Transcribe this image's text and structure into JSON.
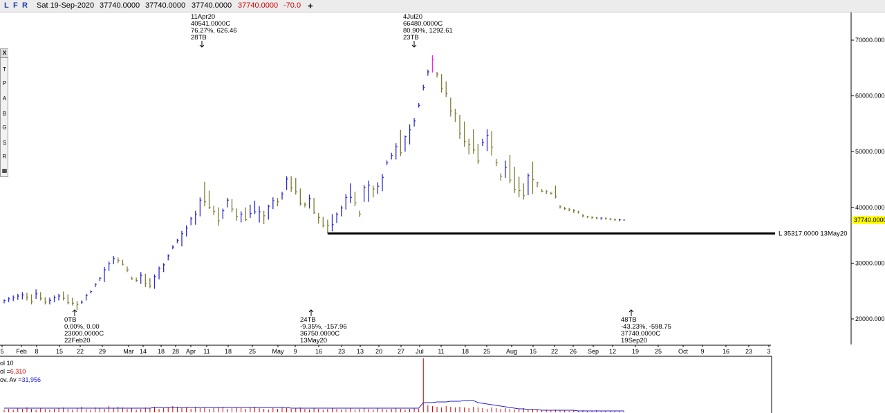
{
  "topbar": {
    "modes": [
      {
        "label": "L",
        "name": "line-mode-button"
      },
      {
        "label": "F",
        "name": "fullscreen-mode-button"
      },
      {
        "label": "R",
        "name": "refresh-mode-button"
      }
    ],
    "date": "Sat 19-Sep-2020",
    "open": "37740.0000",
    "high": "37740.0000",
    "low": "37740.0000",
    "close": "37740.0000",
    "change": "-70.0",
    "add_icon": "plus-icon"
  },
  "toolbar": {
    "close_label": "X",
    "tools": [
      {
        "label": "T",
        "name": "text-tool-button"
      },
      {
        "label": "P",
        "name": "pencil-tool-button"
      },
      {
        "label": "A",
        "name": "arrow-tool-button"
      },
      {
        "label": "B",
        "name": "box-tool-button"
      },
      {
        "label": "G",
        "name": "gann-tool-button"
      },
      {
        "label": "S",
        "name": "speedline-tool-button"
      },
      {
        "label": "R",
        "name": "retracement-tool-button"
      },
      {
        "label": "▦",
        "name": "grid-tool-button"
      }
    ]
  },
  "colors": {
    "up_bar": "#2a2acf",
    "down_bar": "#7f7a33",
    "peak_bar": "#ee22ee",
    "support_line": "#000000",
    "volume_bar": "#d00000",
    "volume_avg": "#2222cc",
    "last_price_bg": "#ffff00"
  },
  "chart_data": {
    "type": "bar",
    "instrument_ohlc_style": "high-low bars with close ticks",
    "y_ticks": [
      "70000.000",
      "60000.000",
      "50000.000",
      "40000.000",
      "30000.000",
      "20000.000"
    ],
    "ylim": [
      16500,
      74000
    ],
    "last_price": "37740.0000",
    "x_labels": [
      "5",
      "Feb",
      "8",
      "15",
      "22",
      "29",
      "Mar",
      "14",
      "18",
      "28",
      "Apr",
      "11",
      "18",
      "25",
      "May",
      "9",
      "16",
      "23",
      "13",
      "20",
      "27",
      "Jul",
      "11",
      "18",
      "25",
      "Aug",
      "15",
      "22",
      "26",
      "Sep",
      "12",
      "19",
      "25",
      "Oct",
      "9",
      "16",
      "23",
      "3"
    ],
    "support_line": {
      "label": "L 35317.0000 13May20",
      "value": 35317
    },
    "annotations": {
      "high_apr": [
        "11Apr20",
        "40541.0000C",
        "76.27%, 626.46",
        "28TB"
      ],
      "high_jul": [
        "4Jul20",
        "66480.0000C",
        "80.90%, 1292.61",
        "23TB"
      ],
      "low_feb": [
        "0TB",
        "0.00%, 0.00",
        "23000.0000C",
        "22Feb20"
      ],
      "low_may": [
        "24TB",
        "-9.35%, -157.96",
        "36750.0000C",
        "13May20"
      ],
      "last_sep": [
        "48TB",
        "-43.23%, -598.75",
        "37740.0000C",
        "19Sep20"
      ]
    },
    "series": [
      {
        "name": "",
        "bars": [
          [
            23500,
            22800,
            23300
          ],
          [
            23900,
            23000,
            23600
          ],
          [
            24200,
            23200,
            23900
          ],
          [
            24500,
            23400,
            24100
          ],
          [
            24800,
            23500,
            24300
          ],
          [
            24700,
            23300,
            23900
          ],
          [
            24400,
            22600,
            23100
          ],
          [
            25300,
            23600,
            24500
          ],
          [
            24800,
            23300,
            23700
          ],
          [
            23900,
            22600,
            23000
          ],
          [
            23800,
            22600,
            23300
          ],
          [
            24200,
            23000,
            23800
          ],
          [
            24500,
            23300,
            24100
          ],
          [
            24900,
            23300,
            23700
          ],
          [
            24400,
            22600,
            22900
          ],
          [
            23800,
            22400,
            22800
          ],
          [
            23200,
            21600,
            22600
          ],
          [
            23300,
            22700,
            23000
          ],
          [
            24500,
            23300,
            24200
          ],
          [
            25100,
            24600,
            24900
          ],
          [
            26400,
            25700,
            26200
          ],
          [
            27500,
            26800,
            27300
          ],
          [
            29300,
            26600,
            28800
          ],
          [
            30300,
            28600,
            29900
          ],
          [
            31300,
            29800,
            30800
          ],
          [
            31000,
            30000,
            30500
          ],
          [
            30600,
            29600,
            29800
          ],
          [
            29400,
            28400,
            28800
          ],
          [
            27600,
            27000,
            27200
          ],
          [
            27400,
            26600,
            26900
          ],
          [
            28400,
            26300,
            27800
          ],
          [
            28100,
            25700,
            26300
          ],
          [
            27300,
            25500,
            25900
          ],
          [
            28000,
            25400,
            27600
          ],
          [
            29400,
            27100,
            29000
          ],
          [
            30000,
            28400,
            29700
          ],
          [
            31600,
            30500,
            31300
          ],
          [
            33200,
            32500,
            32900
          ],
          [
            34400,
            33600,
            34100
          ],
          [
            35800,
            33000,
            35300
          ],
          [
            36800,
            34800,
            36300
          ],
          [
            38300,
            36800,
            38000
          ],
          [
            39400,
            36900,
            38800
          ],
          [
            41800,
            38400,
            41300
          ],
          [
            44600,
            40200,
            41000
          ],
          [
            43000,
            39700,
            40000
          ],
          [
            40300,
            38600,
            39300
          ],
          [
            40000,
            36700,
            37600
          ],
          [
            39800,
            37900,
            39400
          ],
          [
            41700,
            40000,
            41300
          ],
          [
            41500,
            39100,
            39700
          ],
          [
            39800,
            37600,
            38400
          ],
          [
            39300,
            37300,
            38800
          ],
          [
            40000,
            37500,
            37800
          ],
          [
            40500,
            38100,
            38900
          ],
          [
            41200,
            38800,
            39200
          ],
          [
            40200,
            37300,
            39200
          ],
          [
            39400,
            37000,
            38500
          ],
          [
            40500,
            37800,
            40200
          ],
          [
            41800,
            39700,
            41200
          ],
          [
            41700,
            40200,
            41000
          ],
          [
            42800,
            41400,
            42400
          ],
          [
            45600,
            43100,
            45100
          ],
          [
            45600,
            42800,
            43500
          ],
          [
            45300,
            42300,
            42800
          ],
          [
            43400,
            40300,
            40700
          ],
          [
            40900,
            40000,
            40500
          ],
          [
            42300,
            39800,
            41600
          ],
          [
            41700,
            38800,
            39100
          ],
          [
            39000,
            37100,
            38200
          ],
          [
            38300,
            36400,
            36800
          ],
          [
            37800,
            35317,
            36750
          ],
          [
            38800,
            35700,
            36900
          ],
          [
            39100,
            37200,
            38700
          ],
          [
            40300,
            38400,
            39900
          ],
          [
            42400,
            39600,
            41800
          ],
          [
            44300,
            40800,
            41800
          ],
          [
            42800,
            40200,
            40800
          ],
          [
            39400,
            38300,
            38800
          ],
          [
            44000,
            41000,
            43600
          ],
          [
            44800,
            41000,
            44000
          ],
          [
            43900,
            41800,
            43300
          ],
          [
            44500,
            42400,
            43800
          ],
          [
            46000,
            42900,
            45400
          ],
          [
            48400,
            47600,
            48000
          ],
          [
            49800,
            48600,
            49300
          ],
          [
            51500,
            48600,
            50900
          ],
          [
            53900,
            49200,
            49800
          ],
          [
            52900,
            50000,
            52700
          ],
          [
            54900,
            51300,
            53900
          ],
          [
            56000,
            54500,
            55500
          ],
          [
            58700,
            57900,
            58300
          ],
          [
            62000,
            61000,
            61500
          ],
          [
            64700,
            63600,
            64300
          ],
          [
            67300,
            64200,
            66480
          ],
          [
            64300,
            63300,
            63900
          ],
          [
            63900,
            60600,
            61300
          ],
          [
            62600,
            59800,
            60400
          ],
          [
            59700,
            56300,
            57300
          ],
          [
            57700,
            55300,
            56900
          ],
          [
            56600,
            52300,
            53300
          ],
          [
            55400,
            50900,
            51800
          ],
          [
            52300,
            49500,
            51300
          ],
          [
            54000,
            49600,
            50300
          ],
          [
            51400,
            47800,
            48300
          ],
          [
            52300,
            51000,
            51600
          ],
          [
            54000,
            50100,
            52900
          ],
          [
            53700,
            49300,
            50800
          ],
          [
            48700,
            47400,
            48000
          ],
          [
            46100,
            44800,
            45600
          ],
          [
            48400,
            45300,
            47200
          ],
          [
            49400,
            44300,
            44900
          ],
          [
            47300,
            42600,
            43200
          ],
          [
            45500,
            41800,
            43000
          ],
          [
            44300,
            41400,
            42100
          ],
          [
            46100,
            42200,
            45700
          ],
          [
            48200,
            42400,
            45000
          ],
          [
            44600,
            43600,
            44400
          ],
          [
            43300,
            42700,
            42900
          ],
          [
            43100,
            42400,
            42800
          ],
          [
            42800,
            42300,
            42500
          ],
          [
            43900,
            41600,
            41900
          ],
          [
            40400,
            39800,
            40100
          ],
          [
            40100,
            39500,
            39800
          ],
          [
            39900,
            39300,
            39600
          ],
          [
            39700,
            39000,
            39400
          ],
          [
            39400,
            38900,
            39200
          ],
          [
            38800,
            38200,
            38500
          ],
          [
            38500,
            38100,
            38300
          ],
          [
            38400,
            37900,
            38200
          ],
          [
            38300,
            37900,
            38100
          ],
          [
            38200,
            37800,
            38100
          ],
          [
            38200,
            37800,
            38000
          ],
          [
            38100,
            37700,
            37900
          ],
          [
            38000,
            37600,
            37800
          ],
          [
            37900,
            37500,
            37800
          ],
          [
            37900,
            37600,
            37740
          ]
        ]
      }
    ]
  },
  "volume": {
    "title": "ol 10",
    "vol_label": "ol =",
    "vol_value": "6,310",
    "avg_label": "ov. Av =",
    "avg_value": "31,956",
    "bars": [
      4,
      5,
      4,
      6,
      5,
      7,
      5,
      4,
      6,
      5,
      4,
      5,
      6,
      7,
      5,
      4,
      6,
      8,
      5,
      4,
      7,
      6,
      5,
      9,
      6,
      8,
      7,
      5,
      6,
      4,
      5,
      7,
      6,
      8,
      5,
      6,
      7,
      9,
      8,
      6,
      7,
      5,
      8,
      6,
      7,
      5,
      6,
      7,
      8,
      5,
      6,
      7,
      6,
      5,
      7,
      8,
      6,
      5,
      4,
      6,
      5,
      7,
      6,
      5,
      6,
      7,
      5,
      4,
      6,
      5,
      4,
      5,
      6,
      5,
      4,
      5,
      6,
      4,
      5,
      6,
      5,
      4,
      6,
      5,
      4,
      5,
      6,
      5,
      4,
      5,
      6,
      5,
      78,
      10,
      9,
      8,
      7,
      9,
      8,
      7,
      8,
      7,
      6,
      8,
      7,
      6,
      5,
      7,
      6,
      5,
      6,
      5,
      4,
      5,
      6,
      4,
      5,
      4,
      3,
      4,
      3,
      4,
      3,
      3,
      2,
      3,
      2,
      3,
      2,
      2,
      3,
      2,
      2,
      2,
      2,
      2,
      2
    ],
    "avg": [
      6,
      6,
      6,
      6,
      6,
      6,
      6,
      6,
      6,
      6,
      6,
      6,
      6,
      6,
      6,
      6,
      6,
      6,
      6,
      6,
      6,
      6,
      6,
      6,
      6,
      6,
      6,
      6,
      6,
      6,
      6,
      6,
      6,
      7,
      7,
      7,
      7,
      7,
      7,
      7,
      7,
      7,
      7,
      7,
      7,
      7,
      7,
      7,
      7,
      7,
      7,
      7,
      7,
      7,
      7,
      7,
      7,
      7,
      7,
      7,
      7,
      7,
      7,
      6,
      6,
      6,
      6,
      6,
      6,
      6,
      6,
      6,
      6,
      6,
      6,
      6,
      6,
      6,
      6,
      6,
      6,
      6,
      6,
      6,
      6,
      6,
      6,
      6,
      6,
      6,
      6,
      6,
      14,
      14,
      14,
      15,
      15,
      15,
      16,
      16,
      16,
      17,
      17,
      17,
      14,
      13,
      12,
      11,
      10,
      9,
      8,
      7,
      6,
      5,
      5,
      4,
      4,
      4,
      3,
      3,
      3,
      3,
      3,
      3,
      3,
      3,
      2,
      2,
      2,
      2,
      2,
      2,
      2,
      2,
      2,
      2,
      2
    ],
    "max": 80
  }
}
